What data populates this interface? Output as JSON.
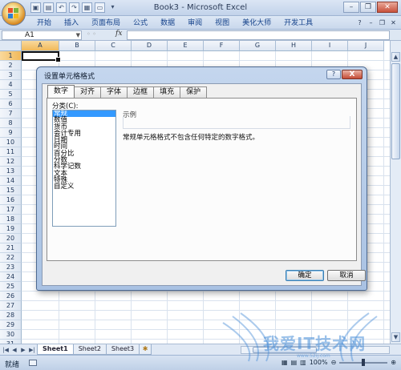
{
  "app": {
    "title": "Book3 - Microsoft Excel"
  },
  "ribbon": {
    "tabs": [
      "开始",
      "插入",
      "页面布局",
      "公式",
      "数据",
      "审阅",
      "视图",
      "美化大师",
      "开发工具"
    ]
  },
  "formula_bar": {
    "name_box": "A1",
    "fx_label": "fx",
    "content": ""
  },
  "columns": [
    "A",
    "B",
    "C",
    "D",
    "E",
    "F",
    "G",
    "H",
    "I",
    "J"
  ],
  "rows": [
    "1",
    "2",
    "3",
    "4",
    "5",
    "6",
    "7",
    "8",
    "9",
    "10",
    "11",
    "12",
    "13",
    "14",
    "15",
    "16",
    "17",
    "18",
    "19",
    "20",
    "21",
    "22",
    "23",
    "24",
    "25",
    "26",
    "27",
    "28",
    "29",
    "30",
    "31",
    "32"
  ],
  "sheets": {
    "tabs": [
      "Sheet1",
      "Sheet2",
      "Sheet3"
    ],
    "active": "Sheet1"
  },
  "status": {
    "ready": "就绪",
    "zoom": "100%"
  },
  "dialog": {
    "title": "设置单元格格式",
    "help": "?",
    "close": "X",
    "tabs": [
      "数字",
      "对齐",
      "字体",
      "边框",
      "填充",
      "保护"
    ],
    "category_label": "分类(C):",
    "categories": [
      "常规",
      "数值",
      "货币",
      "会计专用",
      "日期",
      "时间",
      "百分比",
      "分数",
      "科学记数",
      "文本",
      "特殊",
      "自定义"
    ],
    "selected_category": "常规",
    "sample_label": "示例",
    "description": "常规单元格格式不包含任何特定的数字格式。",
    "ok": "确定",
    "cancel": "取消"
  },
  "watermark": {
    "text": "我爱IT技术网",
    "sub": "www.52ij.com"
  }
}
